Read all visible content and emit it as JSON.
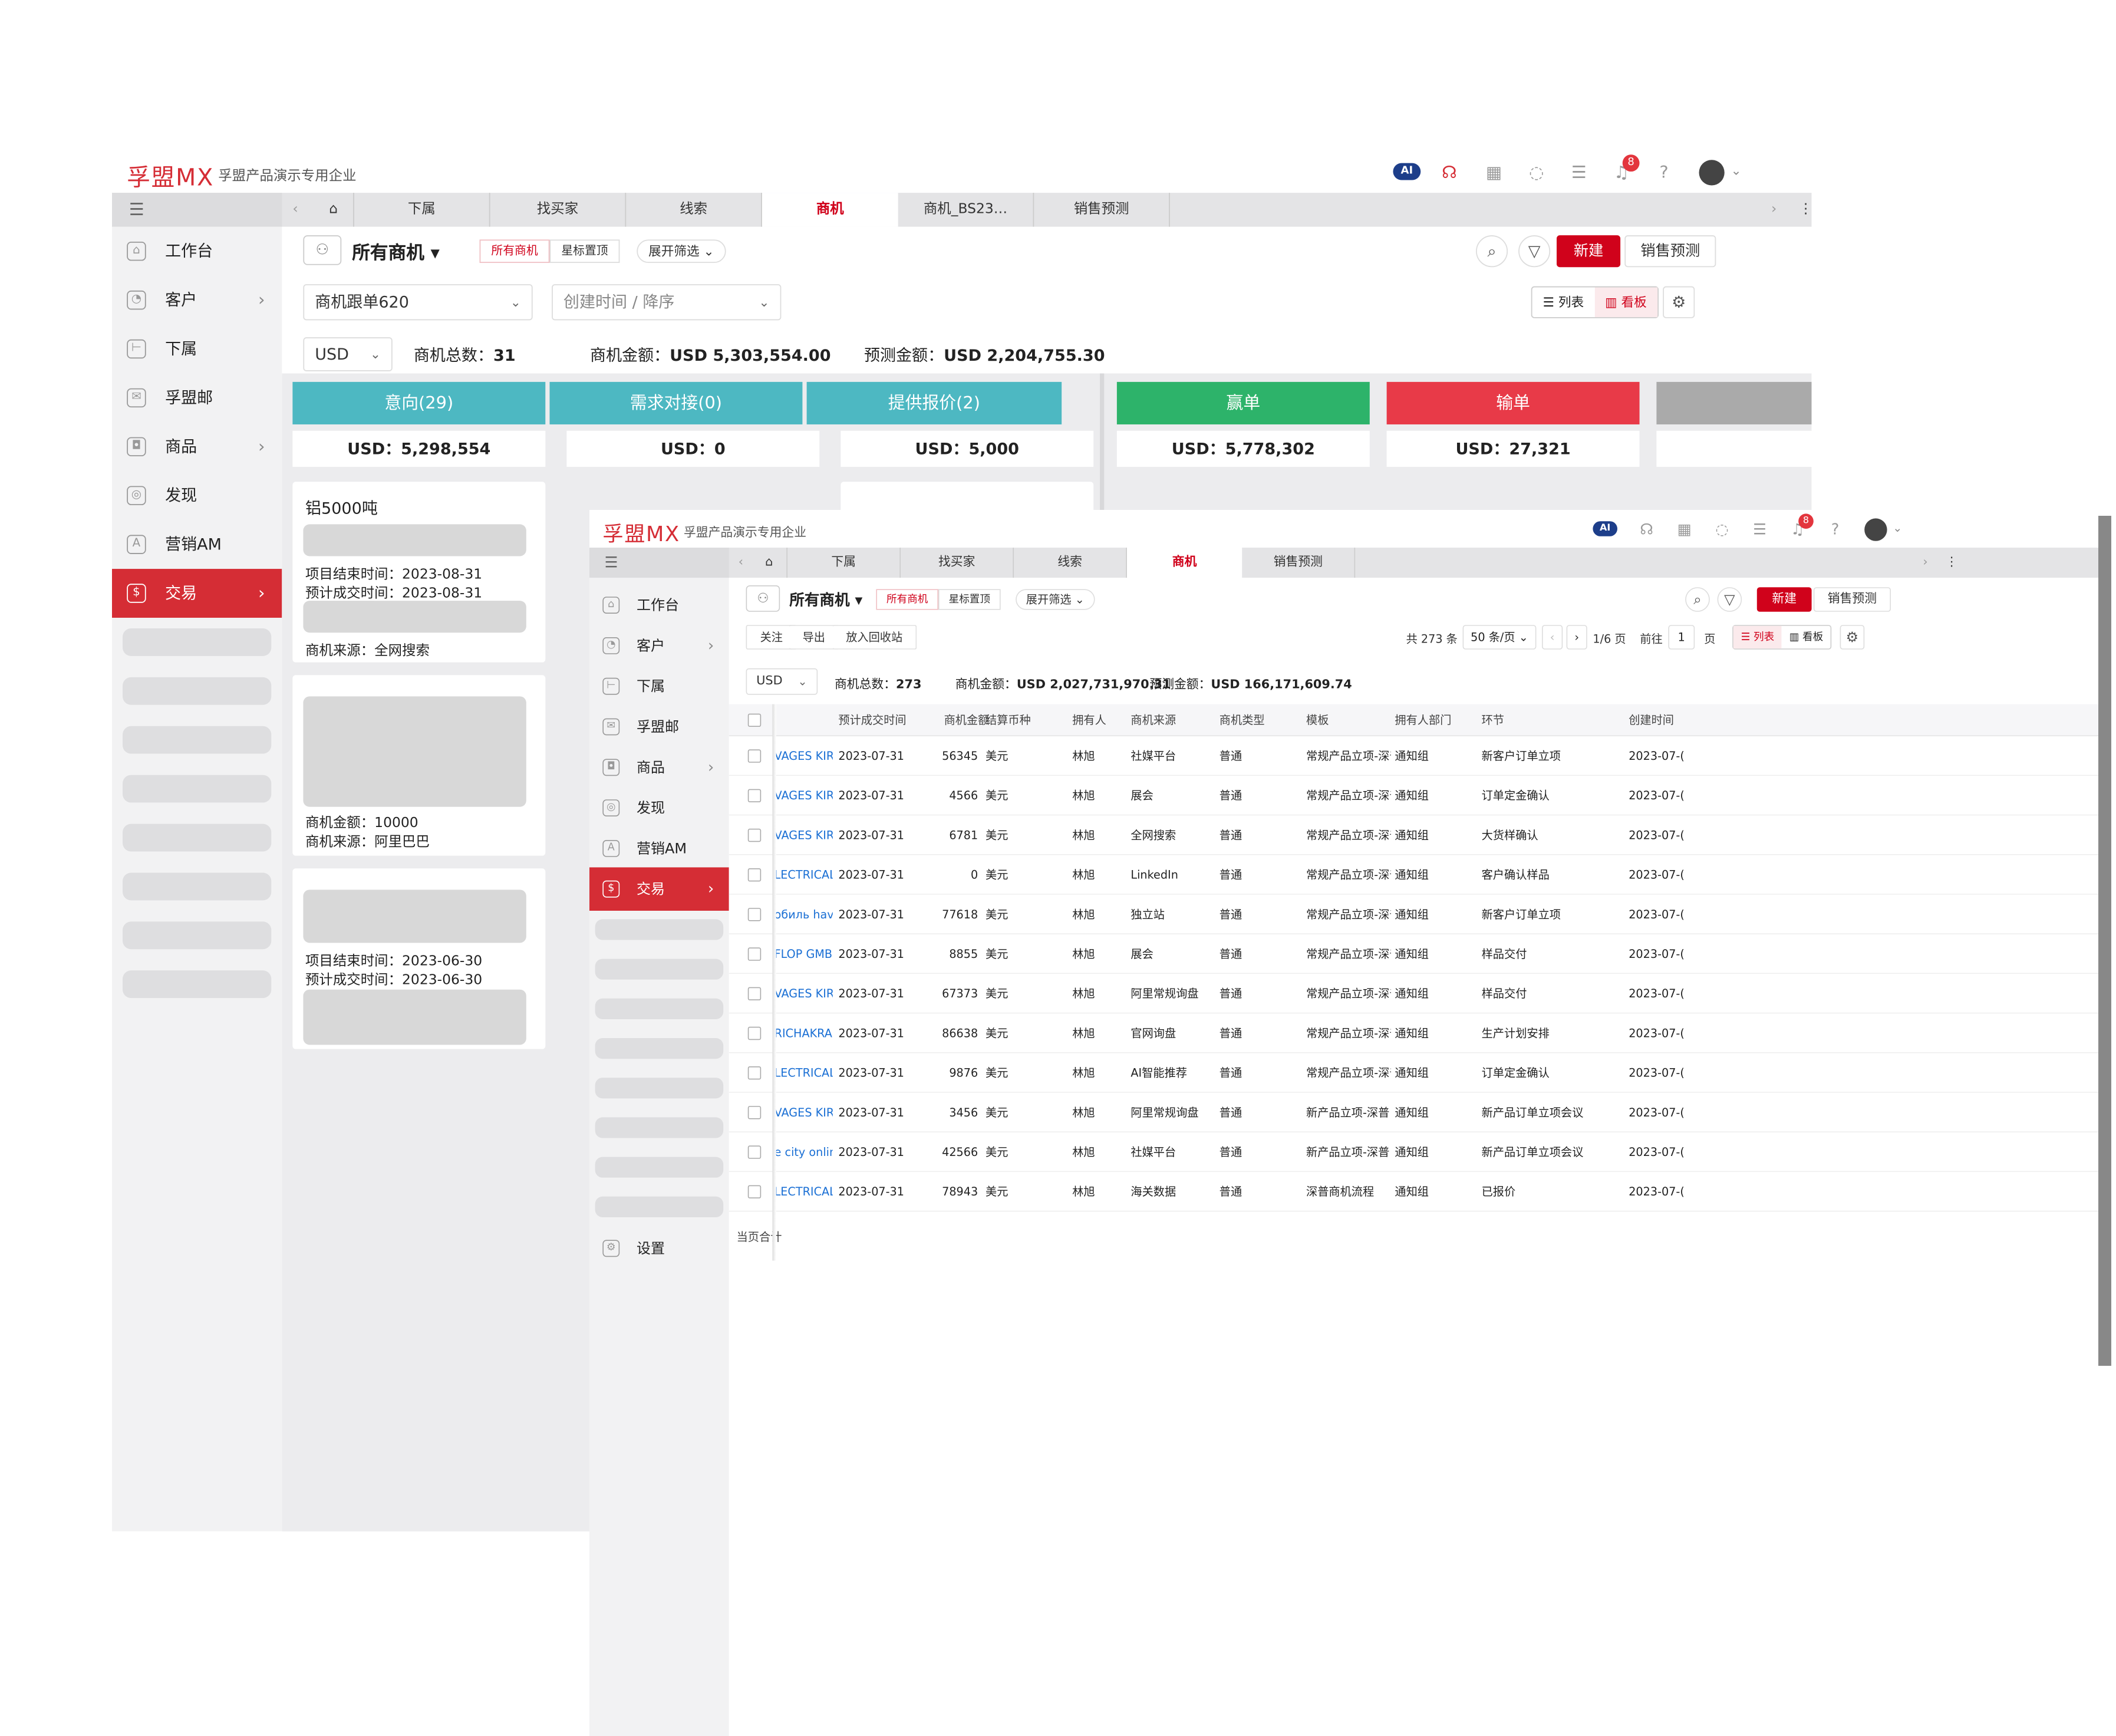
{
  "brand": {
    "logo": "孚盟MX",
    "company": "孚盟产品演示专用企业",
    "notif_count": "8",
    "ai_label": "AI"
  },
  "icons": {
    "headset": "headset-icon",
    "apps": "apps-grid-icon",
    "whatsapp": "whatsapp-icon",
    "tasks": "task-list-icon",
    "bell": "bell-icon",
    "help": "help-icon"
  },
  "colors": {
    "accent": "#d0021b",
    "teal": "#4db8c2",
    "green": "#2db36a",
    "red": "#e83a48"
  },
  "tabs": {
    "sub": "下属",
    "finder": "找买家",
    "leads": "线索",
    "opps": "商机",
    "opp_bs": "商机_BS23…",
    "forecast": "销售预测"
  },
  "nav": {
    "workbench": "工作台",
    "customers": "客户",
    "subordinates": "下属",
    "mail": "孚盟邮",
    "products": "商品",
    "discover": "发现",
    "marketing": "营销AM",
    "deals": "交易",
    "settings": "设置"
  },
  "toolbar": {
    "view_name": "所有商机",
    "pill_all": "所有商机",
    "pill_star": "星标置顶",
    "expand_filter": "展开筛选",
    "new_btn": "新建",
    "forecast_btn": "销售预测",
    "list_label": "列表",
    "board_label": "看板"
  },
  "kanban": {
    "follow_select": "商机跟单620",
    "sort_select": "创建时间 / 降序",
    "currency": "USD",
    "total_label": "商机总数：",
    "total": "31",
    "amount_label": "商机金额：",
    "amount": "USD 5,303,554.00",
    "forecast_label": "预测金额：",
    "forecast": "USD 2,204,755.30",
    "stages": [
      {
        "name": "意向(29)",
        "sum": "USD：5,298,554"
      },
      {
        "name": "需求对接(0)",
        "sum": "USD：0"
      },
      {
        "name": "提供报价(2)",
        "sum": "USD：5,000"
      },
      {
        "name": "赢单",
        "sum": "USD：5,778,302"
      },
      {
        "name": "输单",
        "sum": "USD：27,321"
      }
    ],
    "cards": [
      {
        "title": "铝5000吨",
        "l1k": "项目结束时间：",
        "l1v": "2023-08-31",
        "l2k": "预计成交时间：",
        "l2v": "2023-08-31",
        "l3k": "商机来源：",
        "l3v": "全网搜索"
      },
      {
        "l1k": "商机金额：",
        "l1v": "10000",
        "l2k": "商机来源：",
        "l2v": "阿里巴巴"
      },
      {
        "l1k": "项目结束时间：",
        "l1v": "2023-06-30",
        "l2k": "预计成交时间：",
        "l2v": "2023-06-30"
      }
    ]
  },
  "list": {
    "actions": {
      "follow": "关注",
      "export": "导出",
      "recycle": "放入回收站"
    },
    "pager": {
      "total": "共 273 条",
      "per_page": "50 条/页",
      "page": "1/6 页",
      "goto": "前往",
      "page_input": "1",
      "page_unit": "页"
    },
    "currency": "USD",
    "total_label": "商机总数：",
    "total": "273",
    "amount_label": "商机金额：",
    "amount": "USD 2,027,731,970.31",
    "forecast_label": "预测金额：",
    "forecast": "USD 166,171,609.74",
    "columns": [
      "预计成交时间",
      "商机金额",
      "结算币种",
      "拥有人",
      "商机来源",
      "商机类型",
      "模板",
      "拥有人部门",
      "环节",
      "创建时间"
    ],
    "rows": [
      [
        "VAGES KIRI",
        "2023-07-31",
        "56345",
        "美元",
        "林旭",
        "社媒平台",
        "普通",
        "常规产品立项-深普",
        "通知组",
        "新客户订单立项",
        "2023-07-("
      ],
      [
        "VAGES KIRI",
        "2023-07-31",
        "4566",
        "美元",
        "林旭",
        "展会",
        "普通",
        "常规产品立项-深普",
        "通知组",
        "订单定金确认",
        "2023-07-("
      ],
      [
        "VAGES KIRI",
        "2023-07-31",
        "6781",
        "美元",
        "林旭",
        "全网搜索",
        "普通",
        "常规产品立项-深普",
        "通知组",
        "大货样确认",
        "2023-07-("
      ],
      [
        "LECTRICAL...",
        "2023-07-31",
        "0",
        "美元",
        "林旭",
        "LinkedIn",
        "普通",
        "常规产品立项-深普",
        "通知组",
        "客户确认样品",
        "2023-07-("
      ],
      [
        "обиль hava...",
        "2023-07-31",
        "77618",
        "美元",
        "林旭",
        "独立站",
        "普通",
        "常规产品立项-深普",
        "通知组",
        "新客户订单立项",
        "2023-07-("
      ],
      [
        "FLOP GMBH.",
        "2023-07-31",
        "8855",
        "美元",
        "林旭",
        "展会",
        "普通",
        "常规产品立项-深普",
        "通知组",
        "样品交付",
        "2023-07-("
      ],
      [
        "VAGES KIRI",
        "2023-07-31",
        "67373",
        "美元",
        "林旭",
        "阿里常规询盘",
        "普通",
        "常规产品立项-深普",
        "通知组",
        "样品交付",
        "2023-07-("
      ],
      [
        "RICHAKRA ...",
        "2023-07-31",
        "86638",
        "美元",
        "林旭",
        "官网询盘",
        "普通",
        "常规产品立项-深普",
        "通知组",
        "生产计划安排",
        "2023-07-("
      ],
      [
        "LECTRICAL...",
        "2023-07-31",
        "9876",
        "美元",
        "林旭",
        "AI智能推荐",
        "普通",
        "常规产品立项-深普",
        "通知组",
        "订单定金确认",
        "2023-07-("
      ],
      [
        "VAGES KIRI",
        "2023-07-31",
        "3456",
        "美元",
        "林旭",
        "阿里常规询盘",
        "普通",
        "新产品立项-深普",
        "通知组",
        "新产品订单立项会议",
        "2023-07-("
      ],
      [
        "e city online",
        "2023-07-31",
        "42566",
        "美元",
        "林旭",
        "社媒平台",
        "普通",
        "新产品立项-深普",
        "通知组",
        "新产品订单立项会议",
        "2023-07-("
      ],
      [
        "LECTRICAL...",
        "2023-07-31",
        "78943",
        "美元",
        "林旭",
        "海关数据",
        "普通",
        "深普商机流程",
        "通知组",
        "已报价",
        "2023-07-("
      ]
    ],
    "footer": "当页合计"
  }
}
